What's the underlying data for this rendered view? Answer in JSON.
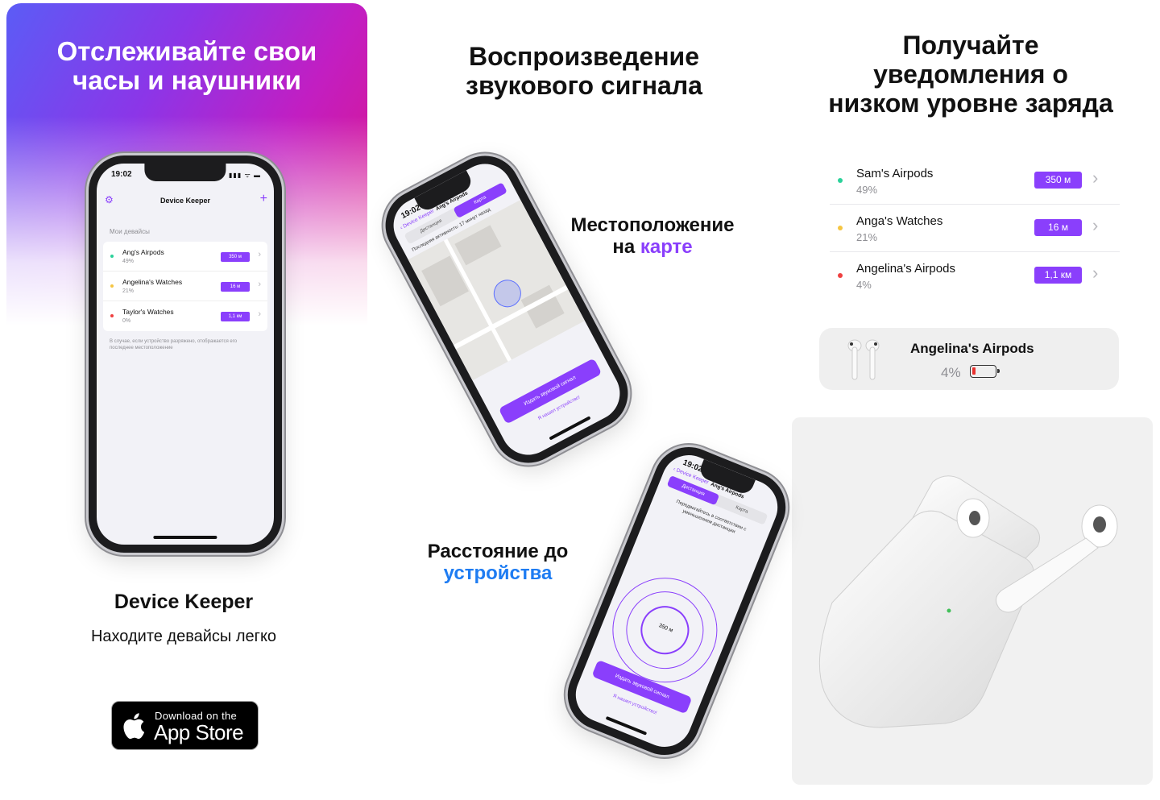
{
  "hero": {
    "title_line1": "Отслеживайте свои",
    "title_line2": "часы и наушники"
  },
  "main_phone": {
    "time": "19:02",
    "status": "▮▮▮ ᯤ ▬",
    "title": "Device Keeper",
    "section": "Мои девайсы",
    "devices": [
      {
        "name": "Ang's Airpods",
        "battery": "49%",
        "distance": "350 м",
        "dot": "#2bd19a"
      },
      {
        "name": "Angelina's Watches",
        "battery": "21%",
        "distance": "16 м",
        "dot": "#f5c542"
      },
      {
        "name": "Taylor's Watches",
        "battery": "0%",
        "distance": "1,1 км",
        "dot": "#ef4040"
      }
    ],
    "note": "В случае, если устройство разряжено, отображается его последнее местоположение"
  },
  "app": {
    "name": "Device Keeper",
    "tagline": "Находите девайсы легко"
  },
  "store": {
    "small": "Download on the",
    "big": "App Store"
  },
  "middle": {
    "title_line1": "Воспроизведение",
    "title_line2": "звукового сигнала",
    "map_label_line1": "Местоположение",
    "map_label_pre": "на ",
    "map_label_accent": "карте",
    "dist_label_line1": "Расстояние до",
    "dist_label_accent": "устройства"
  },
  "tilt_phone_map": {
    "time": "19:02",
    "back": "‹ Device Keeper",
    "title": "Ang's Airpods",
    "tab_a": "Дистанция",
    "tab_b": "Карта",
    "activity": "Последняя активность: 17 минут назад",
    "sound_button": "Издать звуковой сигнал",
    "found_link": "Я нашел устройство!"
  },
  "tilt_phone_dist": {
    "time": "19:02",
    "back": "‹ Device Keeper",
    "title": "Ang's Airpods",
    "tab_a": "Дистанция",
    "tab_b": "Карта",
    "hint": "Передвигайтесь в соответствии с уменьшением дистанции",
    "distance": "350 м",
    "sound_button": "Издать звуковой сигнал",
    "found_link": "Я нашел устройство!"
  },
  "right": {
    "title_line1": "Получайте",
    "title_line2": "уведомления о",
    "title_line3": "низком уровне заряда",
    "devices": [
      {
        "name": "Sam's Airpods",
        "battery": "49%",
        "distance": "350 м",
        "dot": "#2bd19a"
      },
      {
        "name": "Anga's Watches",
        "battery": "21%",
        "distance": "16 м",
        "dot": "#f5c542"
      },
      {
        "name": "Angelina's Airpods",
        "battery": "4%",
        "distance": "1,1 км",
        "dot": "#ef4040"
      }
    ],
    "notification": {
      "device": "Angelina's Airpods",
      "battery": "4%",
      "battery_level": 0.04
    }
  },
  "colors": {
    "accent": "#8a3ffc",
    "blue": "#1e7cf2",
    "low_battery": "#e8322f"
  }
}
